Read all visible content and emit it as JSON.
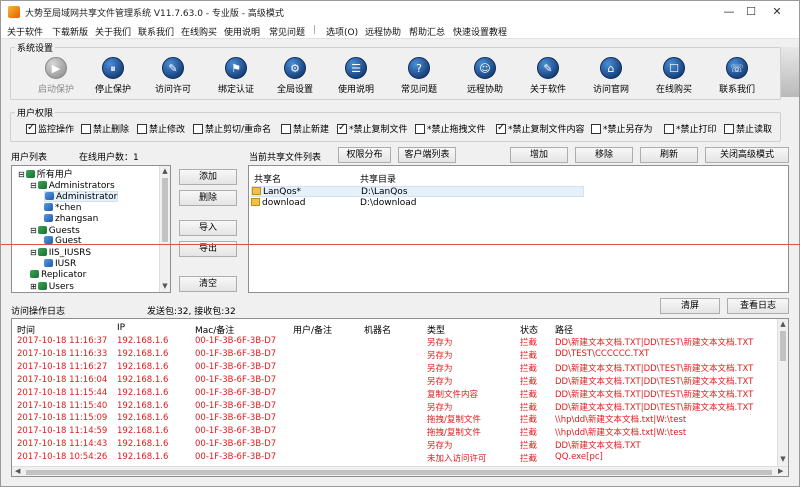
{
  "window": {
    "title": "大势至局域网共享文件管理系统 V11.7.63.0 - 专业版 - 高级模式",
    "min": "—",
    "max": "☐",
    "close": "✕"
  },
  "menu": [
    "关于软件",
    "下载新版",
    "关于我们",
    "联系我们",
    "在线购买",
    "使用说明",
    "常见问题",
    "|",
    "选项(O)",
    "远程协助",
    "帮助汇总",
    "快速设置教程"
  ],
  "toolbar": {
    "group_label": "系统设置",
    "buttons": [
      {
        "label": "启动保护",
        "icon": "▶",
        "disabled": true
      },
      {
        "label": "停止保护",
        "icon": "⏸"
      },
      {
        "label": "访问许可",
        "icon": "✎"
      },
      {
        "label": "绑定认证",
        "icon": "⚑"
      },
      {
        "label": "全局设置",
        "icon": "⚙"
      },
      {
        "label": "使用说明",
        "icon": "☰"
      },
      {
        "label": "常见问题",
        "icon": "?"
      },
      {
        "label": "远程协助",
        "icon": "☺"
      },
      {
        "label": "关于软件",
        "icon": "✎"
      },
      {
        "label": "访问官网",
        "icon": "⌂"
      },
      {
        "label": "在线购买",
        "icon": "☐"
      },
      {
        "label": "联系我们",
        "icon": "☏"
      }
    ]
  },
  "permissions": {
    "group_label": "用户权限",
    "items": [
      {
        "label": "监控操作",
        "checked": true
      },
      {
        "label": "禁止删除",
        "checked": false
      },
      {
        "label": "禁止修改",
        "checked": false
      },
      {
        "label": "禁止剪切/重命名",
        "checked": false
      },
      {
        "label": "禁止新建",
        "checked": false
      },
      {
        "label": "*禁止复制文件",
        "checked": true
      },
      {
        "label": "*禁止拖拽文件",
        "checked": false
      },
      {
        "label": "*禁止复制文件内容",
        "checked": true
      },
      {
        "label": "*禁止另存为",
        "checked": false
      },
      {
        "label": "*禁止打印",
        "checked": false
      },
      {
        "label": "禁止读取",
        "checked": false
      }
    ]
  },
  "users": {
    "label": "用户列表",
    "online": "在线用户数：1",
    "tree": [
      {
        "text": "所有用户",
        "level": 0,
        "type": "group",
        "expander": "⊟"
      },
      {
        "text": "Administrators",
        "level": 1,
        "type": "group",
        "expander": "⊟"
      },
      {
        "text": "Administrator",
        "level": 2,
        "type": "user",
        "selected": true
      },
      {
        "text": "*chen",
        "level": 2,
        "type": "user"
      },
      {
        "text": "zhangsan",
        "level": 2,
        "type": "user"
      },
      {
        "text": "Guests",
        "level": 1,
        "type": "group",
        "expander": "⊟"
      },
      {
        "text": "Guest",
        "level": 2,
        "type": "user"
      },
      {
        "text": "IIS_IUSRS",
        "level": 1,
        "type": "group",
        "expander": "⊟"
      },
      {
        "text": "IUSR",
        "level": 2,
        "type": "user"
      },
      {
        "text": "Replicator",
        "level": 1,
        "type": "group"
      },
      {
        "text": "Users",
        "level": 1,
        "type": "group",
        "expander": "⊞"
      }
    ],
    "buttons": {
      "add": "添加",
      "delete": "删除",
      "import": "导入",
      "export": "导出",
      "clear": "清空"
    }
  },
  "shares": {
    "label": "当前共享文件列表",
    "btn_perm": "权限分布",
    "btn_client": "客户端列表",
    "btn_add": "增加",
    "btn_remove": "移除",
    "btn_refresh": "刷新",
    "btn_close_adv": "关闭高级模式",
    "col_name": "共享名",
    "col_dir": "共享目录",
    "rows": [
      {
        "name": "LanQos*",
        "dir": "D:\\LanQos"
      },
      {
        "name": "download",
        "dir": "D:\\download"
      }
    ]
  },
  "log": {
    "label": "访问操作日志",
    "packets": "发送包:32, 接收包:32",
    "btn_clear": "清屏",
    "btn_view": "查看日志",
    "columns": [
      "时间",
      "IP",
      "Mac/备注",
      "用户/备注",
      "机器名",
      "类型",
      "状态",
      "路径"
    ],
    "rows": [
      {
        "time": "2017-10-18 11:16:37",
        "ip": "192.168.1.6",
        "mac": "00-1F-3B-6F-3B-D7",
        "user": "",
        "host": "",
        "type": "另存为",
        "status": "拦截",
        "path": "DD\\新建文本文档.TXT|DD\\TEST\\新建文本文档.TXT"
      },
      {
        "time": "2017-10-18 11:16:33",
        "ip": "192.168.1.6",
        "mac": "00-1F-3B-6F-3B-D7",
        "user": "",
        "host": "",
        "type": "另存为",
        "status": "拦截",
        "path": "DD\\TEST\\CCCCCC.TXT"
      },
      {
        "time": "2017-10-18 11:16:27",
        "ip": "192.168.1.6",
        "mac": "00-1F-3B-6F-3B-D7",
        "user": "",
        "host": "",
        "type": "另存为",
        "status": "拦截",
        "path": "DD\\新建文本文档.TXT|DD\\TEST\\新建文本文档.TXT"
      },
      {
        "time": "2017-10-18 11:16:04",
        "ip": "192.168.1.6",
        "mac": "00-1F-3B-6F-3B-D7",
        "user": "",
        "host": "",
        "type": "另存为",
        "status": "拦截",
        "path": "DD\\新建文本文档.TXT|DD\\TEST\\新建文本文档.TXT"
      },
      {
        "time": "2017-10-18 11:15:44",
        "ip": "192.168.1.6",
        "mac": "00-1F-3B-6F-3B-D7",
        "user": "",
        "host": "",
        "type": "复制文件内容",
        "status": "拦截",
        "path": "DD\\新建文本文档.TXT|DD\\TEST\\新建文本文档.TXT"
      },
      {
        "time": "2017-10-18 11:15:40",
        "ip": "192.168.1.6",
        "mac": "00-1F-3B-6F-3B-D7",
        "user": "",
        "host": "",
        "type": "另存为",
        "status": "拦截",
        "path": "DD\\新建文本文档.TXT|DD\\TEST\\新建文本文档.TXT"
      },
      {
        "time": "2017-10-18 11:15:09",
        "ip": "192.168.1.6",
        "mac": "00-1F-3B-6F-3B-D7",
        "user": "",
        "host": "",
        "type": "拖拽/复制文件",
        "status": "拦截",
        "path": "\\\\hp\\dd\\新建文本文档.txt|W:\\test"
      },
      {
        "time": "2017-10-18 11:14:59",
        "ip": "192.168.1.6",
        "mac": "00-1F-3B-6F-3B-D7",
        "user": "",
        "host": "",
        "type": "拖拽/复制文件",
        "status": "拦截",
        "path": "\\\\hp\\dd\\新建文本文档.txt|W:\\test"
      },
      {
        "time": "2017-10-18 11:14:43",
        "ip": "192.168.1.6",
        "mac": "00-1F-3B-6F-3B-D7",
        "user": "",
        "host": "",
        "type": "另存为",
        "status": "拦截",
        "path": "DD\\新建文本文档.TXT"
      },
      {
        "time": "2017-10-18 10:54:26",
        "ip": "192.168.1.6",
        "mac": "00-1F-3B-6F-3B-D7",
        "user": "",
        "host": "",
        "type": "未加入访问许可",
        "status": "拦截",
        "path": "QQ.exe[pc]"
      }
    ]
  }
}
